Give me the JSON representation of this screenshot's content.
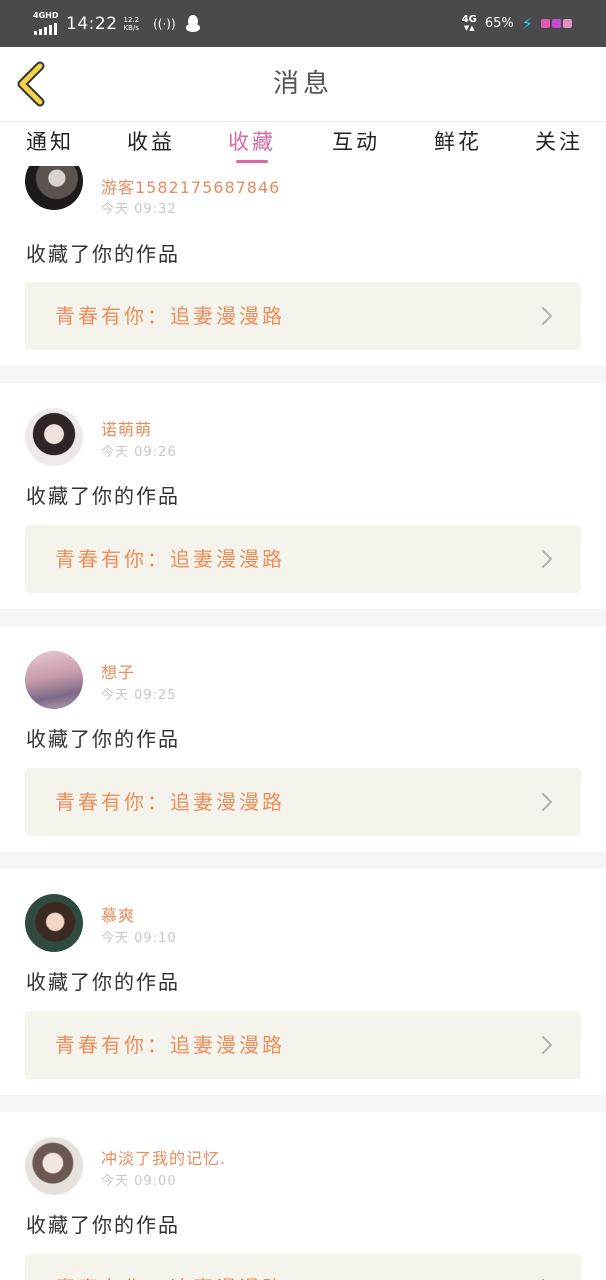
{
  "status_bar": {
    "network_label": "4GHD",
    "time": "14:22",
    "speed_value": "12.2",
    "speed_unit": "KB/s",
    "hotspot": "((·))",
    "signal_label": "4G",
    "signal_arrows": "▼▲",
    "battery": "65%",
    "charging_icon": "bolt-icon"
  },
  "header": {
    "title": "消息",
    "back_icon": "chevron-left-icon",
    "back_color": "#f3d34a"
  },
  "tabs": [
    {
      "label": "通知",
      "active": false
    },
    {
      "label": "收益",
      "active": false
    },
    {
      "label": "收藏",
      "active": true
    },
    {
      "label": "互动",
      "active": false
    },
    {
      "label": "鲜花",
      "active": false
    },
    {
      "label": "关注",
      "active": false
    }
  ],
  "colors": {
    "accent": "#d96aa6",
    "username": "#e88c5e",
    "work_title": "#ec8e5a",
    "work_box_bg": "#f4f3ec",
    "status_bar_bg": "#4a4a4a"
  },
  "messages": [
    {
      "username": "游客15821756​87846",
      "time": "今天 09:32",
      "action": "收藏了你的作品",
      "work_title": "青春有你：追妻漫漫路"
    },
    {
      "username": "诺萌萌",
      "time": "今天 09:26",
      "action": "收藏了你的作品",
      "work_title": "青春有你：追妻漫漫路"
    },
    {
      "username": "想子",
      "time": "今天 09:25",
      "action": "收藏了你的作品",
      "work_title": "青春有你：追妻漫漫路"
    },
    {
      "username": "慕爽",
      "time": "今天 09:10",
      "action": "收藏了你的作品",
      "work_title": "青春有你：追妻漫漫路"
    },
    {
      "username": "冲淡了我的记忆.",
      "time": "今天 09:00",
      "action": "收藏了你的作品",
      "work_title": "青春有你：追妻漫漫路"
    }
  ]
}
